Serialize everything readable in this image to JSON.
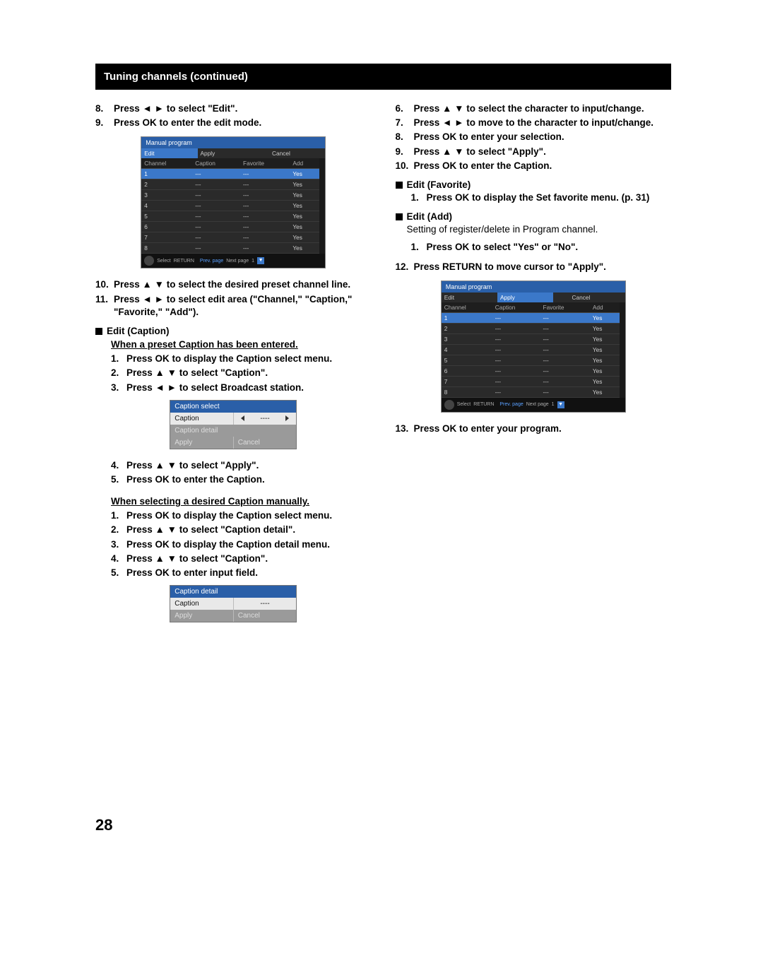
{
  "banner": "Tuning channels (continued)",
  "arrows": {
    "lr": "◄ ►",
    "ud": "▲ ▼"
  },
  "left": {
    "s8": "Press ◄ ► to select \"Edit\".",
    "s9": "Press OK to enter the edit mode.",
    "s10": "Press ▲ ▼ to select the desired preset channel line.",
    "s11": "Press ◄ ► to select edit area (\"Channel,\" \"Caption,\" \"Favorite,\" \"Add\").",
    "h_edit_caption": "Edit (Caption)",
    "u_preset": "When a preset Caption has been entered.",
    "cap_a": {
      "1": "Press OK to display the Caption select menu.",
      "2": "Press ▲ ▼ to select \"Caption\".",
      "3": "Press ◄ ► to select Broadcast station.",
      "4": "Press ▲ ▼ to select \"Apply\".",
      "5": "Press OK to enter the Caption."
    },
    "u_manual": "When selecting a desired Caption manually.",
    "cap_b": {
      "1": "Press OK to display the Caption select menu.",
      "2": "Press ▲ ▼ to select \"Caption detail\".",
      "3": "Press OK to display the Caption detail menu.",
      "4": "Press ▲ ▼ to select \"Caption\".",
      "5": "Press OK to enter input field."
    }
  },
  "right": {
    "s6": "Press ▲ ▼ to select the character to input/change.",
    "s7": "Press ◄ ► to move to the character to input/change.",
    "s8": "Press OK to enter your selection.",
    "s9": "Press ▲ ▼ to select \"Apply\".",
    "s10": "Press OK to enter the Caption.",
    "h_edit_fav": "Edit (Favorite)",
    "fav_1": "Press OK to display the Set favorite menu. (p. 31)",
    "h_edit_add": "Edit (Add)",
    "add_body": "Setting of register/delete in Program channel.",
    "add_1": "Press OK to select \"Yes\" or \"No\".",
    "s12": "Press RETURN to move cursor to \"Apply\".",
    "s13": "Press OK to enter your program."
  },
  "osd": {
    "title": "Manual program",
    "tabs": {
      "edit": "Edit",
      "apply": "Apply",
      "cancel": "Cancel"
    },
    "headers": {
      "channel": "Channel",
      "caption": "Caption",
      "favorite": "Favorite",
      "add": "Add"
    },
    "rows": [
      {
        "ch": "1",
        "cap": "---",
        "fav": "---",
        "add": "Yes"
      },
      {
        "ch": "2",
        "cap": "---",
        "fav": "---",
        "add": "Yes"
      },
      {
        "ch": "3",
        "cap": "---",
        "fav": "---",
        "add": "Yes"
      },
      {
        "ch": "4",
        "cap": "---",
        "fav": "---",
        "add": "Yes"
      },
      {
        "ch": "5",
        "cap": "---",
        "fav": "---",
        "add": "Yes"
      },
      {
        "ch": "6",
        "cap": "---",
        "fav": "---",
        "add": "Yes"
      },
      {
        "ch": "7",
        "cap": "---",
        "fav": "---",
        "add": "Yes"
      },
      {
        "ch": "8",
        "cap": "---",
        "fav": "---",
        "add": "Yes"
      }
    ],
    "footer": {
      "select": "Select",
      "ok": "OK",
      "return": "RETURN",
      "prev": "Prev. page",
      "next": "Next page",
      "page": "1"
    }
  },
  "mini1": {
    "title": "Caption select",
    "caption_label": "Caption",
    "caption_val": "----",
    "detail_label": "Caption detail",
    "apply": "Apply",
    "cancel": "Cancel"
  },
  "mini2": {
    "title": "Caption detail",
    "caption_label": "Caption",
    "caption_val": "----",
    "apply": "Apply",
    "cancel": "Cancel"
  },
  "page_number": "28"
}
